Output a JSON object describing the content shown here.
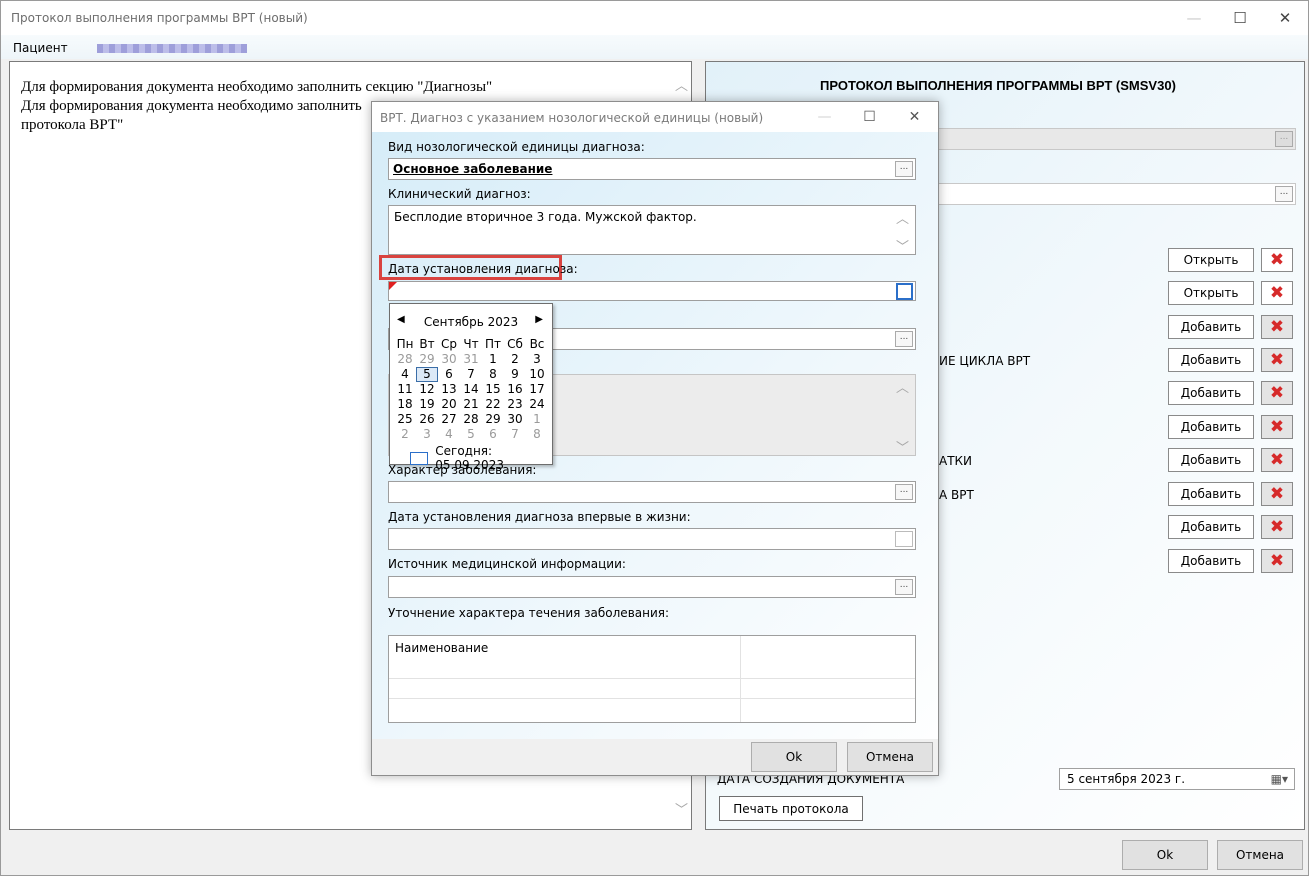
{
  "main_window": {
    "title": "Протокол выполнения программы ВРТ (новый)",
    "minimize": "—",
    "maximize": "☐",
    "close": "✕",
    "patient_label": "Пациент",
    "left_text": [
      "Для формирования документа необходимо заполнить секцию \"Диагнозы\"",
      "Для формирования документа необходимо заполнить",
      "протокола ВРТ\""
    ],
    "right_title": "ПРОТОКОЛ ВЫПОЛНЕНИЯ ПРОГРАММЫ ВРТ (SMSV30)",
    "right_label_partials": [
      "ИЕ ЦИКЛА ВРТ",
      "АТКИ",
      "А ВРТ"
    ],
    "row_buttons": [
      "Открыть",
      "Открыть",
      "Добавить",
      "Добавить",
      "Добавить",
      "Добавить",
      "Добавить",
      "Добавить",
      "Добавить",
      "Добавить"
    ],
    "doc_date_label": "ДАТА СОЗДАНИЯ ДОКУМЕНТА",
    "doc_date_value": "5 сентября 2023 г.",
    "print_button": "Печать протокола",
    "ok": "Ok",
    "cancel": "Отмена"
  },
  "dialog": {
    "title": "ВРТ. Диагноз с указанием нозологической единицы (новый)",
    "minimize": "—",
    "maximize": "☐",
    "close": "✕",
    "nosology_label": "Вид нозологической единицы диагноза:",
    "nosology_value": "Основное заболевание",
    "clinical_label": "Клинический диагноз:",
    "clinical_value": "Бесплодие вторичное 3 года. Мужской фактор.",
    "date_label": "Дата установления диагноза:",
    "character_label": "Характер заболевания:",
    "first_date_label": "Дата установления диагноза впервые в жизни:",
    "source_label": "Источник медицинской информации:",
    "clarification_label": "Уточнение характера течения заболевания:",
    "grid_header": "Наименование",
    "ok": "Ok",
    "cancel": "Отмена"
  },
  "calendar": {
    "month_year": "Сентябрь 2023",
    "weekdays": [
      "Пн",
      "Вт",
      "Ср",
      "Чт",
      "Пт",
      "Сб",
      "Вс"
    ],
    "weeks": [
      [
        "28",
        "29",
        "30",
        "31",
        "1",
        "2",
        "3"
      ],
      [
        "4",
        "5",
        "6",
        "7",
        "8",
        "9",
        "10"
      ],
      [
        "11",
        "12",
        "13",
        "14",
        "15",
        "16",
        "17"
      ],
      [
        "18",
        "19",
        "20",
        "21",
        "22",
        "23",
        "24"
      ],
      [
        "25",
        "26",
        "27",
        "28",
        "29",
        "30",
        "1"
      ],
      [
        "2",
        "3",
        "4",
        "5",
        "6",
        "7",
        "8"
      ]
    ],
    "selected_day": "5",
    "today_text": "Сегодня: 05.09.2023"
  }
}
